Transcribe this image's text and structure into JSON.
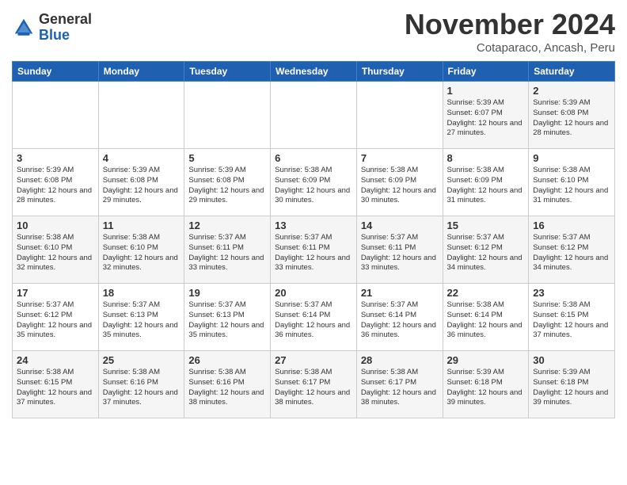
{
  "logo": {
    "general": "General",
    "blue": "Blue"
  },
  "title": "November 2024",
  "subtitle": "Cotaparaco, Ancash, Peru",
  "days_of_week": [
    "Sunday",
    "Monday",
    "Tuesday",
    "Wednesday",
    "Thursday",
    "Friday",
    "Saturday"
  ],
  "weeks": [
    [
      {
        "day": "",
        "info": ""
      },
      {
        "day": "",
        "info": ""
      },
      {
        "day": "",
        "info": ""
      },
      {
        "day": "",
        "info": ""
      },
      {
        "day": "",
        "info": ""
      },
      {
        "day": "1",
        "info": "Sunrise: 5:39 AM\nSunset: 6:07 PM\nDaylight: 12 hours\nand 27 minutes."
      },
      {
        "day": "2",
        "info": "Sunrise: 5:39 AM\nSunset: 6:08 PM\nDaylight: 12 hours\nand 28 minutes."
      }
    ],
    [
      {
        "day": "3",
        "info": "Sunrise: 5:39 AM\nSunset: 6:08 PM\nDaylight: 12 hours\nand 28 minutes."
      },
      {
        "day": "4",
        "info": "Sunrise: 5:39 AM\nSunset: 6:08 PM\nDaylight: 12 hours\nand 29 minutes."
      },
      {
        "day": "5",
        "info": "Sunrise: 5:39 AM\nSunset: 6:08 PM\nDaylight: 12 hours\nand 29 minutes."
      },
      {
        "day": "6",
        "info": "Sunrise: 5:38 AM\nSunset: 6:09 PM\nDaylight: 12 hours\nand 30 minutes."
      },
      {
        "day": "7",
        "info": "Sunrise: 5:38 AM\nSunset: 6:09 PM\nDaylight: 12 hours\nand 30 minutes."
      },
      {
        "day": "8",
        "info": "Sunrise: 5:38 AM\nSunset: 6:09 PM\nDaylight: 12 hours\nand 31 minutes."
      },
      {
        "day": "9",
        "info": "Sunrise: 5:38 AM\nSunset: 6:10 PM\nDaylight: 12 hours\nand 31 minutes."
      }
    ],
    [
      {
        "day": "10",
        "info": "Sunrise: 5:38 AM\nSunset: 6:10 PM\nDaylight: 12 hours\nand 32 minutes."
      },
      {
        "day": "11",
        "info": "Sunrise: 5:38 AM\nSunset: 6:10 PM\nDaylight: 12 hours\nand 32 minutes."
      },
      {
        "day": "12",
        "info": "Sunrise: 5:37 AM\nSunset: 6:11 PM\nDaylight: 12 hours\nand 33 minutes."
      },
      {
        "day": "13",
        "info": "Sunrise: 5:37 AM\nSunset: 6:11 PM\nDaylight: 12 hours\nand 33 minutes."
      },
      {
        "day": "14",
        "info": "Sunrise: 5:37 AM\nSunset: 6:11 PM\nDaylight: 12 hours\nand 33 minutes."
      },
      {
        "day": "15",
        "info": "Sunrise: 5:37 AM\nSunset: 6:12 PM\nDaylight: 12 hours\nand 34 minutes."
      },
      {
        "day": "16",
        "info": "Sunrise: 5:37 AM\nSunset: 6:12 PM\nDaylight: 12 hours\nand 34 minutes."
      }
    ],
    [
      {
        "day": "17",
        "info": "Sunrise: 5:37 AM\nSunset: 6:12 PM\nDaylight: 12 hours\nand 35 minutes."
      },
      {
        "day": "18",
        "info": "Sunrise: 5:37 AM\nSunset: 6:13 PM\nDaylight: 12 hours\nand 35 minutes."
      },
      {
        "day": "19",
        "info": "Sunrise: 5:37 AM\nSunset: 6:13 PM\nDaylight: 12 hours\nand 35 minutes."
      },
      {
        "day": "20",
        "info": "Sunrise: 5:37 AM\nSunset: 6:14 PM\nDaylight: 12 hours\nand 36 minutes."
      },
      {
        "day": "21",
        "info": "Sunrise: 5:37 AM\nSunset: 6:14 PM\nDaylight: 12 hours\nand 36 minutes."
      },
      {
        "day": "22",
        "info": "Sunrise: 5:38 AM\nSunset: 6:14 PM\nDaylight: 12 hours\nand 36 minutes."
      },
      {
        "day": "23",
        "info": "Sunrise: 5:38 AM\nSunset: 6:15 PM\nDaylight: 12 hours\nand 37 minutes."
      }
    ],
    [
      {
        "day": "24",
        "info": "Sunrise: 5:38 AM\nSunset: 6:15 PM\nDaylight: 12 hours\nand 37 minutes."
      },
      {
        "day": "25",
        "info": "Sunrise: 5:38 AM\nSunset: 6:16 PM\nDaylight: 12 hours\nand 37 minutes."
      },
      {
        "day": "26",
        "info": "Sunrise: 5:38 AM\nSunset: 6:16 PM\nDaylight: 12 hours\nand 38 minutes."
      },
      {
        "day": "27",
        "info": "Sunrise: 5:38 AM\nSunset: 6:17 PM\nDaylight: 12 hours\nand 38 minutes."
      },
      {
        "day": "28",
        "info": "Sunrise: 5:38 AM\nSunset: 6:17 PM\nDaylight: 12 hours\nand 38 minutes."
      },
      {
        "day": "29",
        "info": "Sunrise: 5:39 AM\nSunset: 6:18 PM\nDaylight: 12 hours\nand 39 minutes."
      },
      {
        "day": "30",
        "info": "Sunrise: 5:39 AM\nSunset: 6:18 PM\nDaylight: 12 hours\nand 39 minutes."
      }
    ]
  ]
}
